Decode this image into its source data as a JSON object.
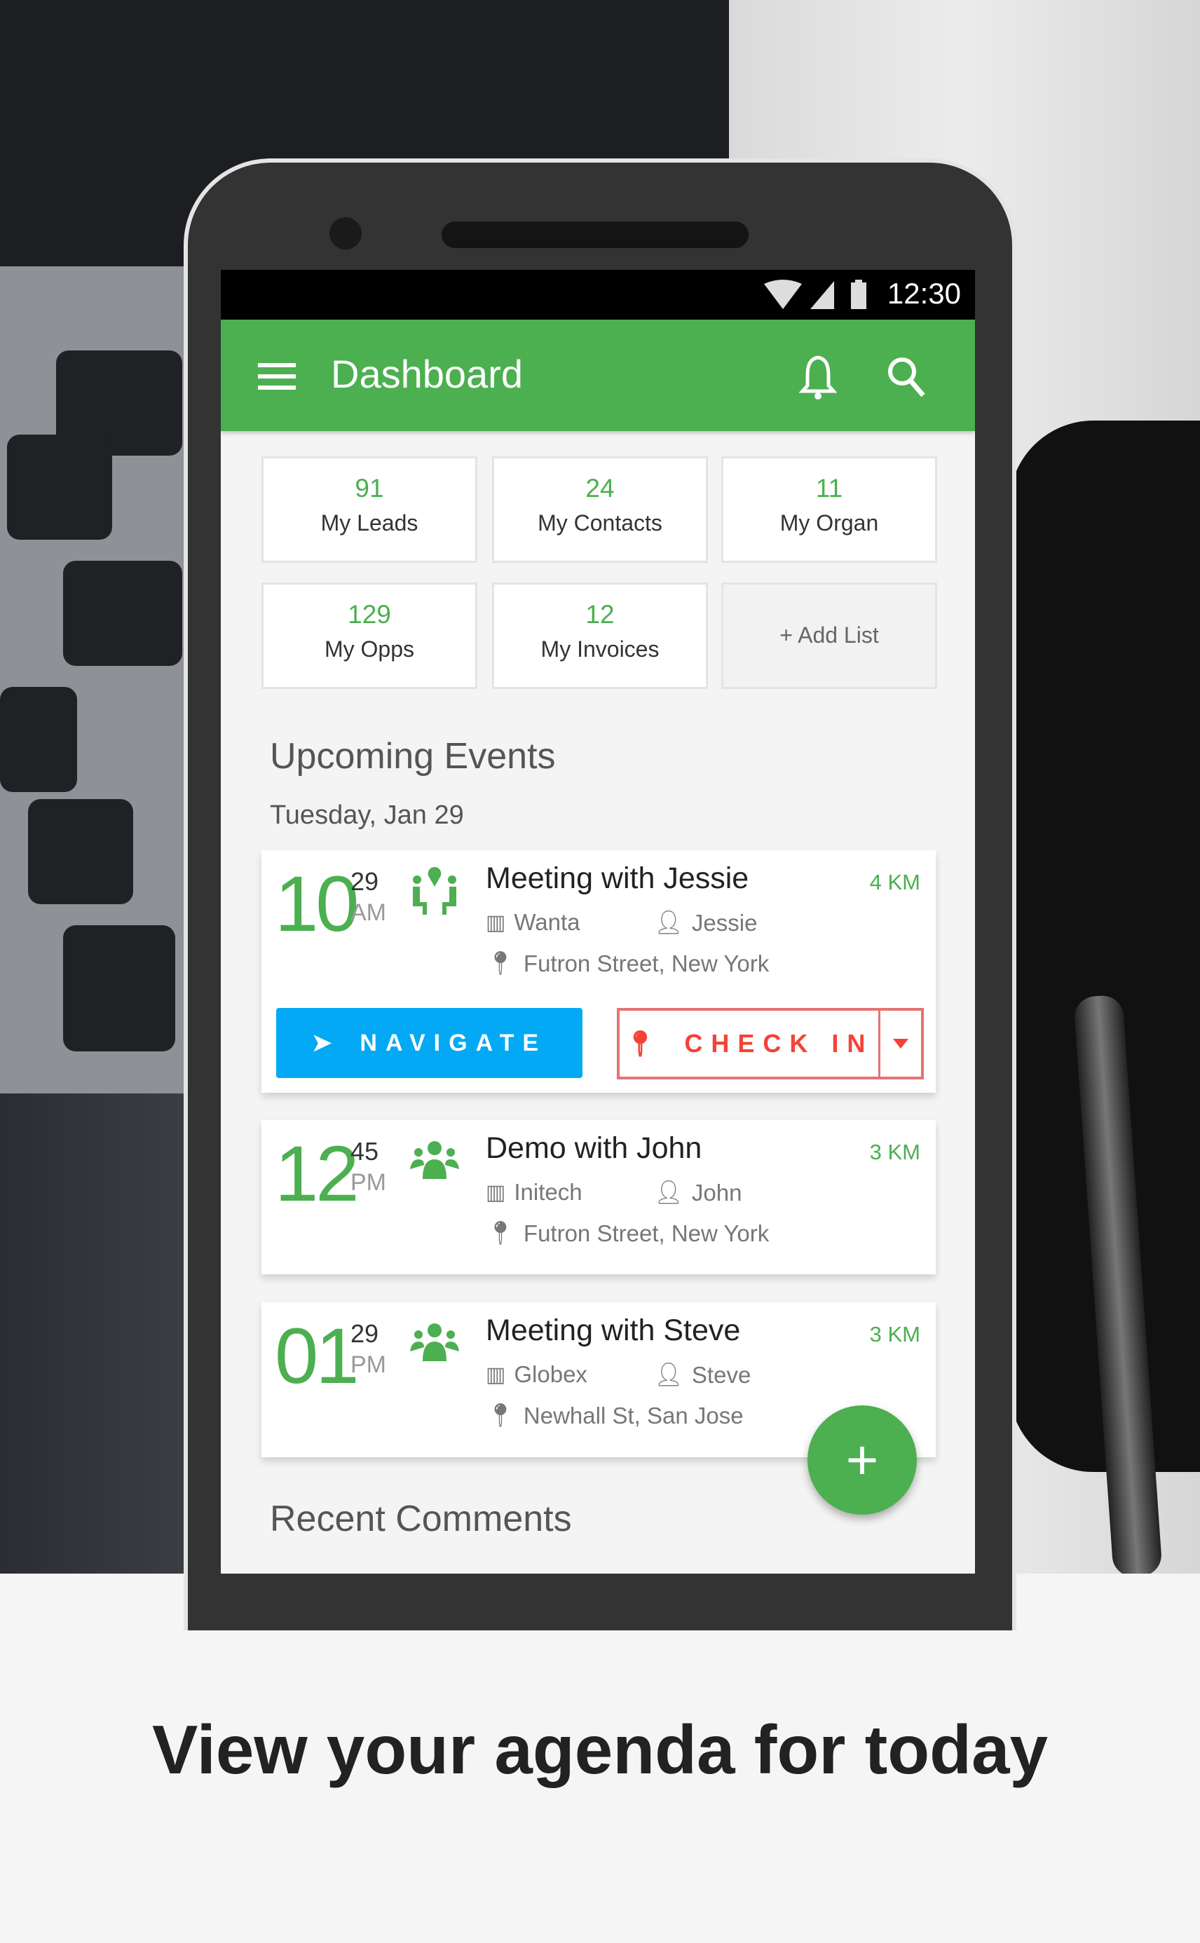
{
  "status_bar": {
    "time": "12:30",
    "icons": [
      "wifi-icon",
      "signal-icon",
      "battery-icon"
    ]
  },
  "app_bar": {
    "title": "Dashboard",
    "menu_icon": "hamburger-icon",
    "actions": [
      "bell-icon",
      "search-icon"
    ]
  },
  "tiles": [
    {
      "count": "91",
      "label": "My Leads"
    },
    {
      "count": "24",
      "label": "My Contacts"
    },
    {
      "count": "11",
      "label": "My Organ"
    },
    {
      "count": "129",
      "label": "My Opps"
    },
    {
      "count": "12",
      "label": "My Invoices"
    }
  ],
  "add_list_label": "+ Add List",
  "upcoming": {
    "heading": "Upcoming Events",
    "date": "Tuesday, Jan 29"
  },
  "events": [
    {
      "hour": "10",
      "minute": "29",
      "ampm": "AM",
      "title": "Meeting with Jessie",
      "distance": "4 KM",
      "company": "Wanta",
      "contact": "Jessie",
      "address": "Futron Street, New York",
      "navigate_label": "NAVIGATE",
      "checkin_label": "CHECK IN"
    },
    {
      "hour": "12",
      "minute": "45",
      "ampm": "PM",
      "title": "Demo with John",
      "distance": "3 KM",
      "company": "Initech",
      "contact": "John",
      "address": "Futron Street, New York"
    },
    {
      "hour": "01",
      "minute": "29",
      "ampm": "PM",
      "title": "Meeting with Steve",
      "distance": "3 KM",
      "company": "Globex",
      "contact": "Steve",
      "address": "Newhall St, San Jose"
    }
  ],
  "recent_comments_heading": "Recent Comments",
  "fab_label": "+",
  "caption": "View your agenda for today",
  "colors": {
    "primary": "#4caf50",
    "navigate": "#03a9f4",
    "checkin": "#f44336"
  }
}
